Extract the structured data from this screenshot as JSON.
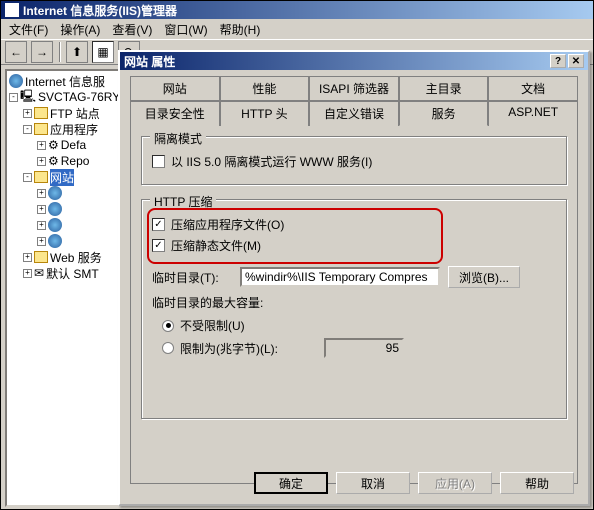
{
  "window": {
    "title": "Internet 信息服务(IIS)管理器"
  },
  "menu": {
    "file": "文件(F)",
    "action": "操作(A)",
    "view": "查看(V)",
    "window": "窗口(W)",
    "help": "帮助(H)"
  },
  "tree": {
    "root": "Internet 信息服",
    "server": "SVCTAG-76RY",
    "ftp": "FTP 站点",
    "apppool": "应用程序",
    "defa": "Defa",
    "repo": "Repo",
    "websites": "网站",
    "webserv": "Web 服务",
    "defsmt": "默认 SMT"
  },
  "dialog": {
    "title": "网站 属性",
    "tabs_row1": [
      "网站",
      "性能",
      "ISAPI 筛选器",
      "主目录",
      "文档"
    ],
    "tabs_row2": [
      "目录安全性",
      "HTTP 头",
      "自定义错误",
      "服务",
      "ASP.NET"
    ],
    "isolation": {
      "group": "隔离模式",
      "chk": "以 IIS 5.0 隔离模式运行 WWW 服务(I)"
    },
    "compress": {
      "group": "HTTP 压缩",
      "chk1": "压缩应用程序文件(O)",
      "chk2": "压缩静态文件(M)",
      "tempdir_label": "临时目录(T):",
      "tempdir_value": "%windir%\\IIS Temporary Compres",
      "browse": "浏览(B)...",
      "maxlabel": "临时目录的最大容量:",
      "unlimited": "不受限制(U)",
      "limited": "限制为(兆字节)(L):",
      "limit_value": "95"
    },
    "buttons": {
      "ok": "确定",
      "cancel": "取消",
      "apply": "应用(A)",
      "help": "帮助"
    }
  }
}
